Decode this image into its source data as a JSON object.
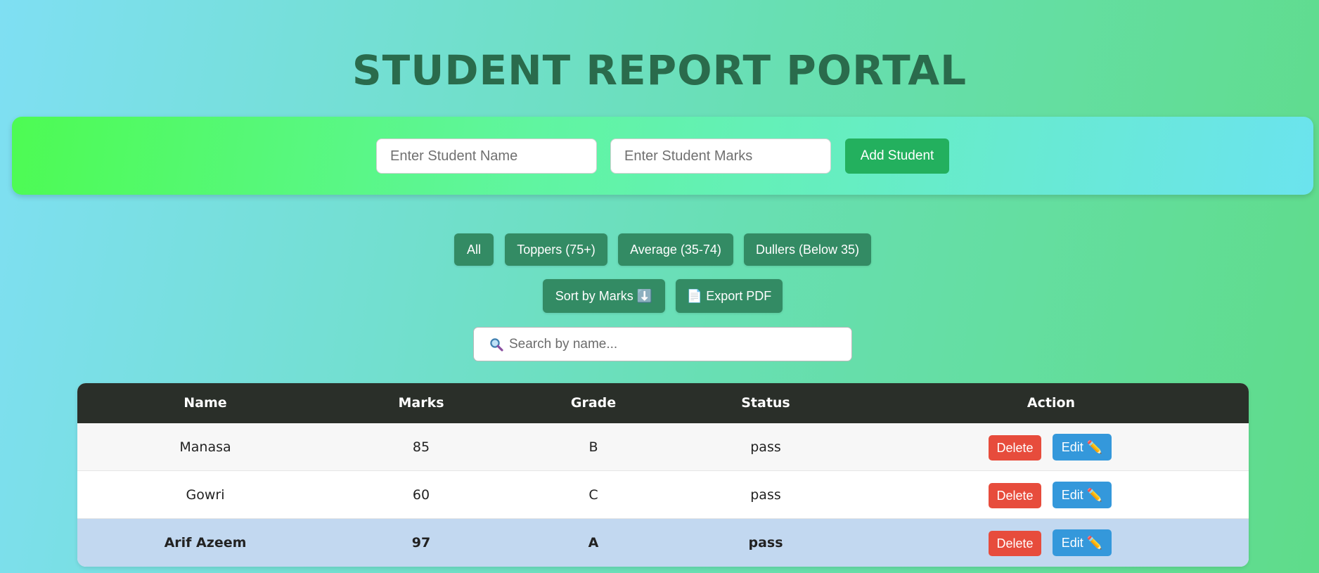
{
  "page": {
    "title": "STUDENT REPORT PORTAL"
  },
  "form": {
    "name_placeholder": "Enter Student Name",
    "marks_placeholder": "Enter Student Marks",
    "add_label": "Add Student"
  },
  "filters": [
    {
      "label": "All"
    },
    {
      "label": "Toppers (75+)"
    },
    {
      "label": "Average (35-74)"
    },
    {
      "label": "Dullers (Below 35)"
    }
  ],
  "controls": {
    "sort_label": "Sort by Marks ⬇️",
    "export_label": "📄 Export PDF"
  },
  "search": {
    "placeholder": "Search by name...",
    "icon": "magnifier-icon"
  },
  "table": {
    "headers": {
      "name": "Name",
      "marks": "Marks",
      "grade": "Grade",
      "status": "Status",
      "action": "Action"
    },
    "rows": [
      {
        "name": "Manasa",
        "marks": "85",
        "grade": "B",
        "status": "pass",
        "delete": "Delete",
        "edit": "Edit ✏️"
      },
      {
        "name": "Gowri",
        "marks": "60",
        "grade": "C",
        "status": "pass",
        "delete": "Delete",
        "edit": "Edit ✏️"
      },
      {
        "name": "Arif Azeem",
        "marks": "97",
        "grade": "A",
        "status": "pass",
        "delete": "Delete",
        "edit": "Edit ✏️"
      }
    ]
  },
  "colors": {
    "title": "#2a6b4c",
    "primary_green": "#23b05e",
    "filter_green": "#338b64",
    "header_dark": "#2a2f29",
    "delete_red": "#e74c3c",
    "edit_blue": "#3498db",
    "highlight_row": "#c2d8f0"
  }
}
